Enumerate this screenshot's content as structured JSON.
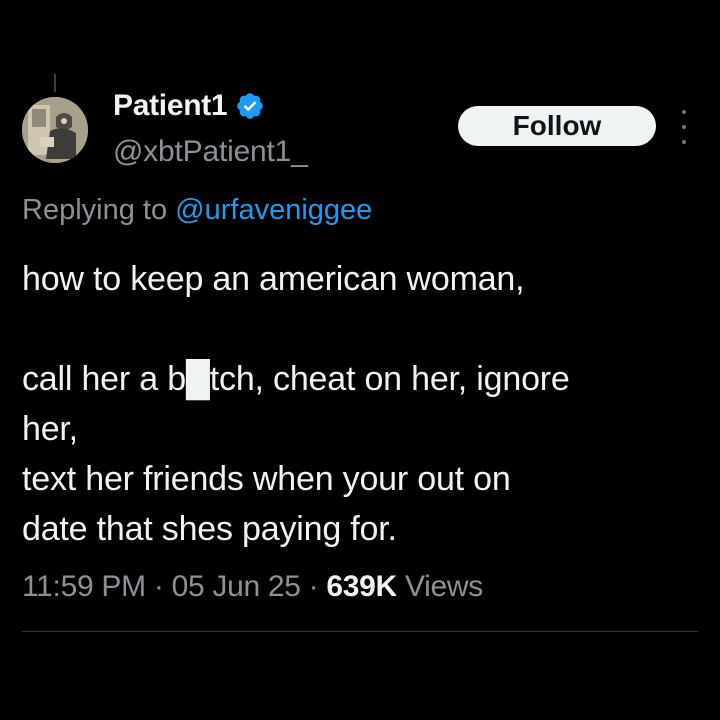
{
  "author": {
    "display_name": "Patient1",
    "handle": "@xbtPatient1_",
    "verified": true,
    "avatar_icon": "avatar-artwork"
  },
  "actions": {
    "follow_label": "Follow",
    "more_icon": "more-vertical-icon"
  },
  "reply": {
    "prefix": "Replying to ",
    "mention": "@urfaveniggee"
  },
  "tweet": {
    "text": "how to keep an american woman,\n\ncall her a b█tch, cheat on her, ignore\nher,\ntext her friends when your out on\ndate that shes paying for."
  },
  "meta": {
    "time": "11:59 PM",
    "separator": " · ",
    "date": "05 Jun 25",
    "views_count": "639K",
    "views_label": " Views"
  },
  "colors": {
    "background": "#000000",
    "text": "#eff3f4",
    "secondary": "#8b9197",
    "accent": "#1d9bf0",
    "verified": "#1d9bf0"
  }
}
